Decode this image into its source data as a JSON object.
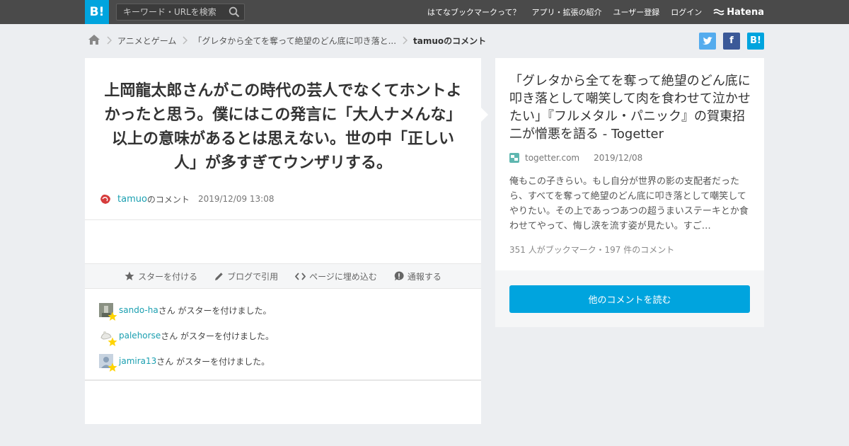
{
  "header": {
    "logo_text": "B!",
    "search_placeholder": "キーワード・URLを検索",
    "nav": [
      "はてなブックマークって？",
      "アプリ・拡張の紹介",
      "ユーザー登録",
      "ログイン"
    ],
    "brand": "Hatena"
  },
  "breadcrumb": {
    "items": [
      "アニメとゲーム",
      "「グレタから全てを奪って絶望のどん底に叩き落と..."
    ],
    "current": "tamuoのコメント"
  },
  "share": {
    "twitter_label": "twitter",
    "facebook_label": "f",
    "hatena_label": "B!"
  },
  "comment": {
    "text": "上岡龍太郎さんがこの時代の芸人でなくてホントよかったと思う。僕にはこの発言に「大人ナメんな」以上の意味があるとは思えない。世の中「正しい人」が多すぎてウンザリする。",
    "user": "tamuo",
    "user_suffix": "のコメント",
    "date": "2019/12/09 13:08"
  },
  "actions": [
    "スターを付ける",
    "ブログで引用",
    "ページに埋め込む",
    "通報する"
  ],
  "stars": [
    {
      "user": "sando-ha",
      "text": "さん がスターを付けました。"
    },
    {
      "user": "palehorse",
      "text": "さん がスターを付けました。"
    },
    {
      "user": "jamira13",
      "text": "さん がスターを付けました。"
    }
  ],
  "entry": {
    "title": "「グレタから全てを奪って絶望のどん底に叩き落として嘲笑して肉を食わせて泣かせたい」『フルメタル・パニック』の賀東招二が憎悪を語る - Togetter",
    "site": "togetter.com",
    "date": "2019/12/08",
    "description": "俺もこの子きらい。もし自分が世界の影の支配者だったら、すべてを奪って絶望のどん底に叩き落として嘲笑してやりたい。その上であっつあつの超うまいステーキとか食わせてやって、悔し涙を流す姿が見たい。すご…",
    "counts": "351 人がブックマーク・197 件のコメント",
    "read_button": "他のコメントを読む"
  },
  "colors": {
    "accent": "#00a4de",
    "link": "#1a9fb0",
    "star": "#ffd400"
  }
}
